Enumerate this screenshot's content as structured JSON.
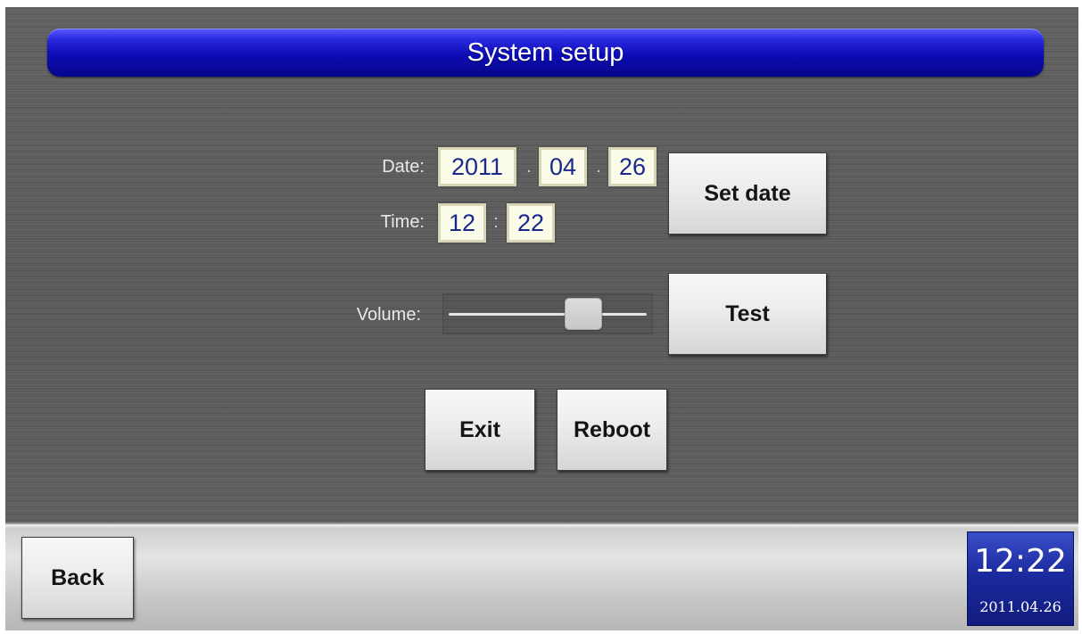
{
  "header": {
    "title": "System setup"
  },
  "date": {
    "label": "Date:",
    "year": "2011",
    "month": "04",
    "day": "26",
    "separator": "."
  },
  "time": {
    "label": "Time:",
    "hour": "12",
    "minute": "22",
    "separator": ":"
  },
  "volume": {
    "label": "Volume:",
    "level": 0.72
  },
  "buttons": {
    "set_date": "Set date",
    "test": "Test",
    "exit": "Exit",
    "reboot": "Reboot"
  },
  "footer": {
    "back": "Back",
    "clock_time": "12:22",
    "clock_date": "2011.04.26"
  },
  "colors": {
    "title_bar": "#0c0cb4",
    "field_text": "#1a2a8c",
    "clock_background": "#1b2a9e"
  }
}
